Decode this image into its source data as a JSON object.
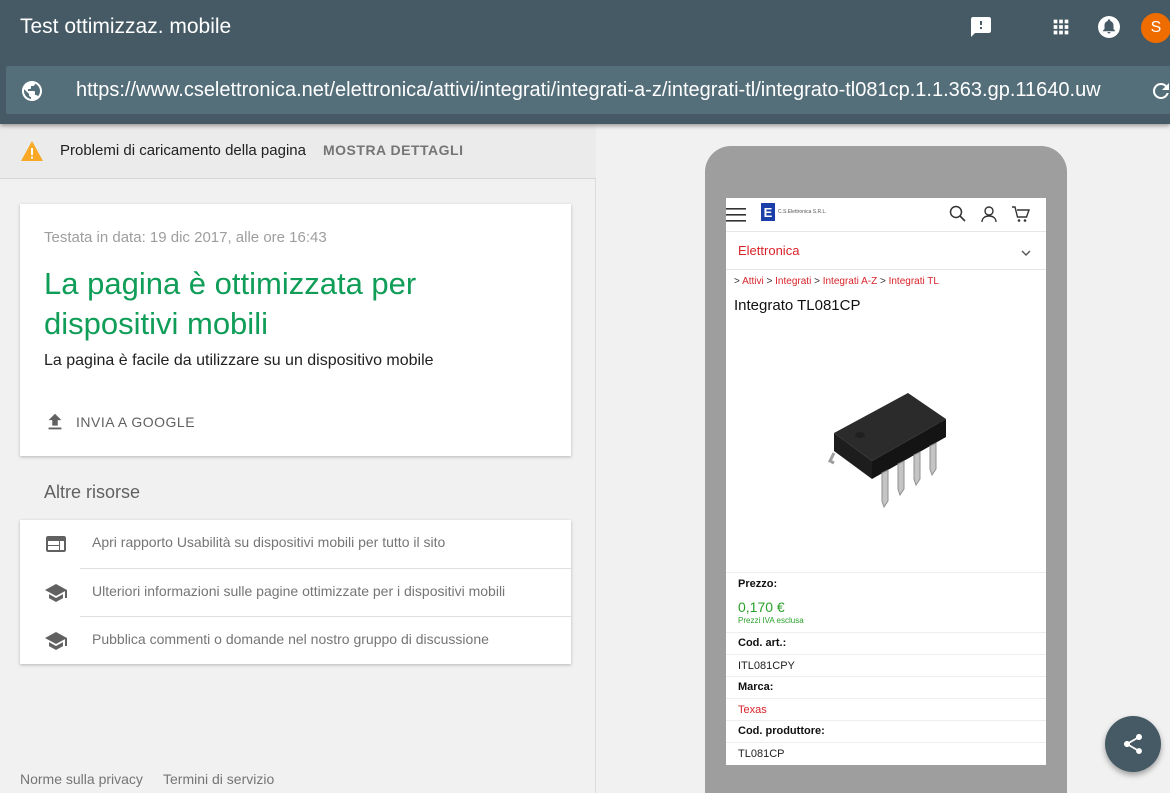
{
  "app": {
    "title": "Test ottimizzaz. mobile",
    "avatar_letter": "S"
  },
  "url_bar": {
    "url": "https://www.cselettronica.net/elettronica/attivi/integrati/integrati-a-z/integrati-tl/integrato-tl081cp.1.1.363.gp.11640.uw"
  },
  "warning": {
    "text": "Problemi di caricamento della pagina",
    "link": "MOSTRA DETTAGLI"
  },
  "result": {
    "tested_date": "Testata in data: 19 dic 2017, alle ore 16:43",
    "heading": "La pagina è ottimizzata per dispositivi mobili",
    "subtext": "La pagina è facile da utilizzare su un dispositivo mobile",
    "send_label": "INVIA A GOOGLE"
  },
  "resources": {
    "title": "Altre risorse",
    "items": [
      {
        "label": "Apri rapporto Usabilità su dispositivi mobili per tutto il sito",
        "icon": "web-icon"
      },
      {
        "label": "Ulteriori informazioni sulle pagine ottimizzate per i dispositivi mobili",
        "icon": "school-icon"
      },
      {
        "label": "Pubblica commenti o domande nel nostro gruppo di discussione",
        "icon": "school-icon"
      }
    ]
  },
  "footer": {
    "privacy": "Norme sulla privacy",
    "terms": "Termini di servizio"
  },
  "mobile_preview": {
    "logo_letter": "E",
    "logo_text": "C.S.Elettronica S.R.L.",
    "category": "Elettronica",
    "breadcrumb": {
      "prefix": ">",
      "items": [
        "Attivi",
        "Integrati",
        "Integrati A-Z",
        "Integrati TL"
      ],
      "separator": ">"
    },
    "product_title": "Integrato TL081CP",
    "price_label": "Prezzo:",
    "price_value": "0,170 €",
    "price_note": "Prezzi IVA esclusa",
    "code_label": "Cod. art.:",
    "code_value": "ITL081CPY",
    "brand_label": "Marca:",
    "brand_value": "Texas",
    "mfr_code_label": "Cod. produttore:",
    "mfr_code_value": "TL081CP"
  },
  "colors": {
    "appbar": "#455a64",
    "urlbar": "#546e7a",
    "success_green": "#0f9d58",
    "avatar": "#ef6c00",
    "brand_red": "#d8232a",
    "price_green": "#2aa12a",
    "warning_amber": "#f9a825"
  }
}
